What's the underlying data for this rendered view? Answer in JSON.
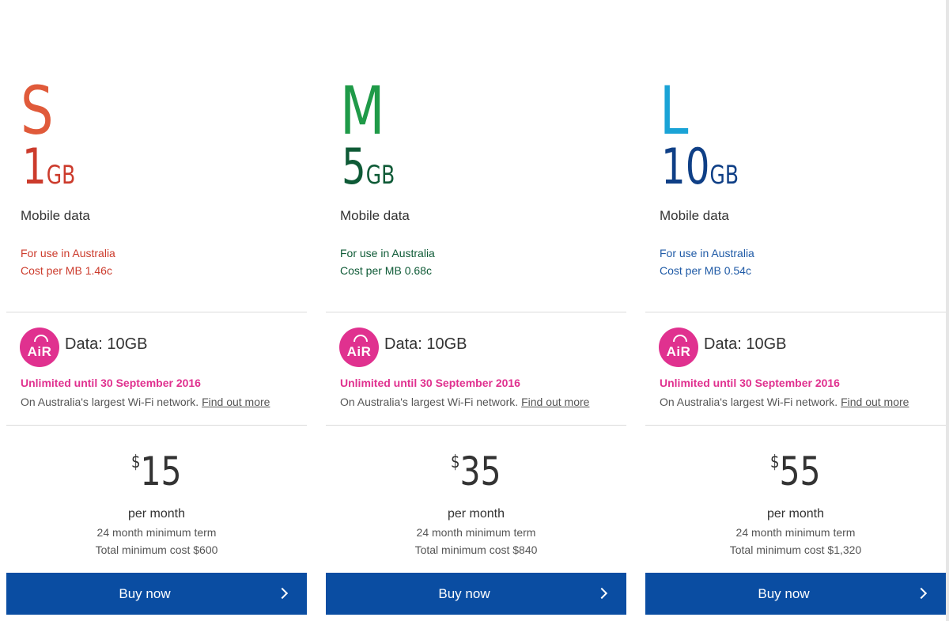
{
  "plans": [
    {
      "size": "S",
      "amount": "1",
      "unit": "GB",
      "data_label": "Mobile data",
      "usage_line": "For use in Australia",
      "cost_per_mb": "Cost per MB 1.46c",
      "air_logo": "AiR",
      "air_data": "Data: 10GB",
      "air_promo": "Unlimited until 30 September 2016",
      "air_network": "On Australia's largest Wi-Fi network.",
      "air_link": "Find out more",
      "currency": "$",
      "price": "15",
      "per_month": "per month",
      "term": "24 month minimum term",
      "total": "Total minimum cost $600",
      "buy_label": "Buy now",
      "accent_size": "#e05a3a",
      "accent_amount": "#cc3b2c",
      "accent_usage": "#cc3b2c"
    },
    {
      "size": "M",
      "amount": "5",
      "unit": "GB",
      "data_label": "Mobile data",
      "usage_line": "For use in Australia",
      "cost_per_mb": "Cost per MB 0.68c",
      "air_logo": "AiR",
      "air_data": "Data: 10GB",
      "air_promo": "Unlimited until 30 September 2016",
      "air_network": "On Australia's largest Wi-Fi network.",
      "air_link": "Find out more",
      "currency": "$",
      "price": "35",
      "per_month": "per month",
      "term": "24 month minimum term",
      "total": "Total minimum cost $840",
      "buy_label": "Buy now",
      "accent_size": "#1f9a48",
      "accent_amount": "#0e5a36",
      "accent_usage": "#0e5a36"
    },
    {
      "size": "L",
      "amount": "10",
      "unit": "GB",
      "data_label": "Mobile data",
      "usage_line": "For use in Australia",
      "cost_per_mb": "Cost per MB 0.54c",
      "air_logo": "AiR",
      "air_data": "Data: 10GB",
      "air_promo": "Unlimited until 30 September 2016",
      "air_network": "On Australia's largest Wi-Fi network.",
      "air_link": "Find out more",
      "currency": "$",
      "price": "55",
      "per_month": "per month",
      "term": "24 month minimum term",
      "total": "Total minimum cost $1,320",
      "buy_label": "Buy now",
      "accent_size": "#1aa3d6",
      "accent_amount": "#0f3f86",
      "accent_usage": "#1f5aa6"
    }
  ],
  "colors": {
    "button": "#0a4da2",
    "air_pink": "#e0318f",
    "divider": "#dcdcdc"
  },
  "icons": {
    "air_logo": "air-wifi-logo",
    "buy_arrow": "chevron-right-icon"
  }
}
